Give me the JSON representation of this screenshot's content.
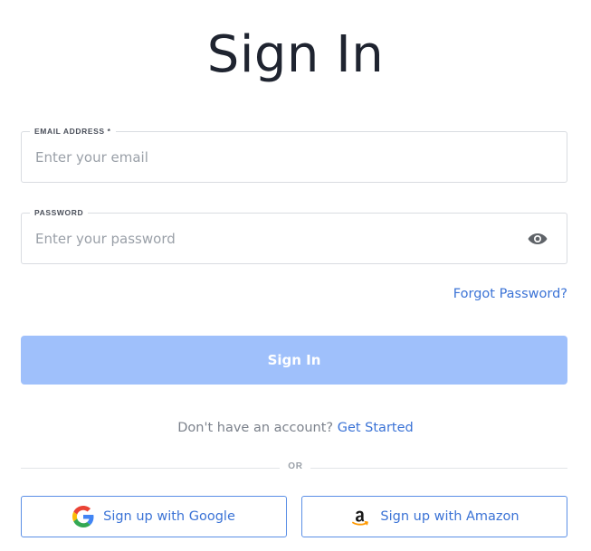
{
  "title": "Sign In",
  "email": {
    "label": "EMAIL ADDRESS *",
    "placeholder": "Enter your email",
    "value": ""
  },
  "password": {
    "label": "PASSWORD",
    "placeholder": "Enter your password",
    "value": "",
    "toggle_icon": "eye-icon"
  },
  "forgot_password": "Forgot Password?",
  "signin_button": "Sign In",
  "signup_prompt": {
    "text": "Don't have an account?",
    "link": "Get Started"
  },
  "divider": "OR",
  "social": {
    "google": {
      "label": "Sign up with Google",
      "icon": "google-icon"
    },
    "amazon": {
      "label": "Sign up with Amazon",
      "icon": "amazon-icon"
    }
  },
  "colors": {
    "accent": "#3b73d6",
    "button_disabled": "#9fc0fb",
    "border": "#d9dce1"
  }
}
